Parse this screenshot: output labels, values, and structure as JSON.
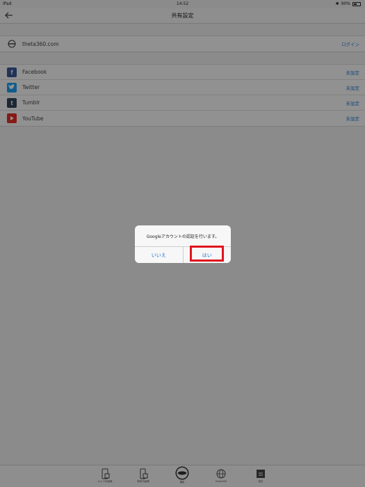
{
  "status_bar": {
    "device": "iPad",
    "time": "14:52",
    "battery": "90%"
  },
  "nav": {
    "title": "共有設定",
    "back_icon": "back-arrow-icon"
  },
  "account_section": [
    {
      "icon": "theta-icon",
      "label": "theta360.com",
      "action": "ログイン"
    }
  ],
  "social_section": [
    {
      "icon": "facebook-icon",
      "label": "Facebook",
      "action": "未設定"
    },
    {
      "icon": "twitter-icon",
      "label": "Twitter",
      "action": "未設定"
    },
    {
      "icon": "tumblr-icon",
      "label": "Tumblr",
      "action": "未設定"
    },
    {
      "icon": "youtube-icon",
      "label": "YouTube",
      "action": "未設定"
    }
  ],
  "dialog": {
    "message": "Googleアカウントの認証を行います。",
    "no_label": "いいえ",
    "yes_label": "はい"
  },
  "colors": {
    "accent": "#1e72d3",
    "highlight": "#e0141e"
  },
  "tab_bar": [
    {
      "icon": "camera-list-icon",
      "label": "カメラ内画像"
    },
    {
      "icon": "device-list-icon",
      "label": "端末内画像"
    },
    {
      "icon": "shutter-icon",
      "label": "撮影"
    },
    {
      "icon": "globe-icon",
      "label": "theta360"
    },
    {
      "icon": "settings-icon",
      "label": "設定"
    }
  ]
}
